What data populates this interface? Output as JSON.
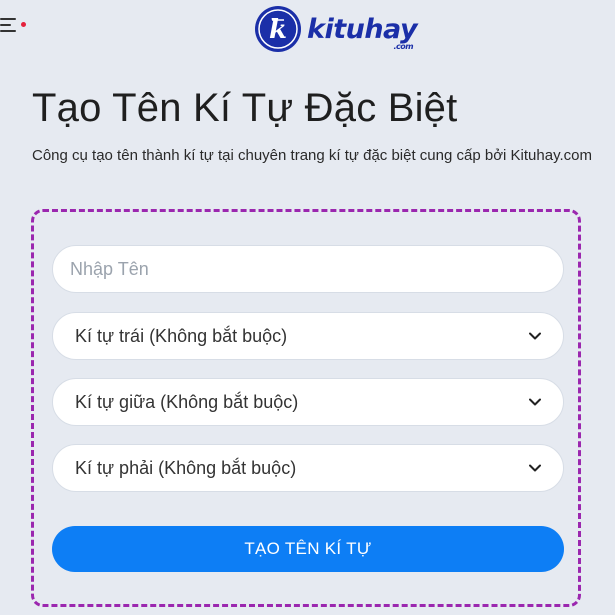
{
  "header": {
    "menu_icon": "menu-icon",
    "logo": {
      "text": "kituhay",
      "subtext": ".com",
      "mark_letter": "k",
      "color": "#1b2fa8"
    }
  },
  "main": {
    "title": "Tạo Tên Kí Tự Đặc Biệt",
    "description": "Công cụ tạo tên thành kí tự tại chuyên trang kí tự đặc biệt cung cấp bởi Kituhay.com"
  },
  "form": {
    "name_input": {
      "placeholder": "Nhập Tên",
      "value": ""
    },
    "left_char_select": {
      "selected": "Kí tự trái (Không bắt buộc)"
    },
    "middle_char_select": {
      "selected": "Kí tự giữa (Không bắt buộc)"
    },
    "right_char_select": {
      "selected": "Kí tự phải (Không bắt buộc)"
    },
    "submit_label": "TẠO TÊN KÍ TỰ",
    "border_color": "#9b27af",
    "button_color": "#0d7ef5"
  }
}
